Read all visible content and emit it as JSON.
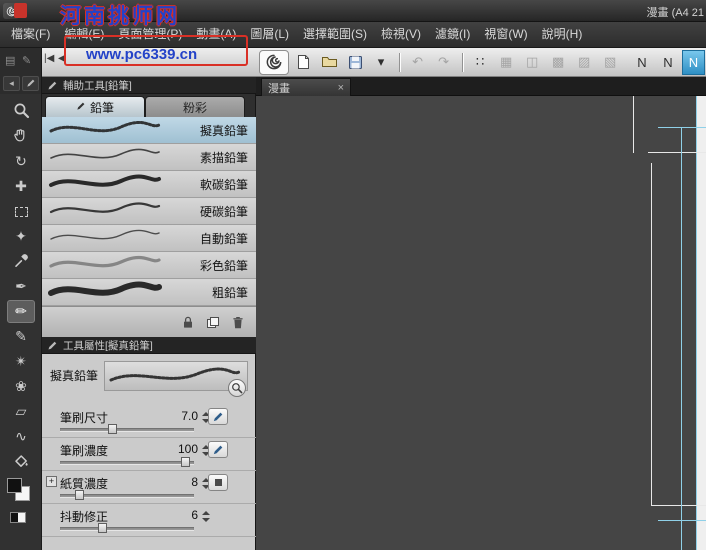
{
  "window": {
    "title": "漫畫 (A4 21"
  },
  "watermark": {
    "line1": "河南挑师网",
    "line2": "www.pc6339.cn"
  },
  "menu": {
    "items": [
      {
        "id": "file",
        "label": "檔案(F)"
      },
      {
        "id": "edit",
        "label": "編輯(E)"
      },
      {
        "id": "page-manage",
        "label": "頁面管理(P)"
      },
      {
        "id": "animation",
        "label": "動畫(A)"
      },
      {
        "id": "layer",
        "label": "圖層(L)"
      },
      {
        "id": "selection",
        "label": "選擇範圍(S)"
      },
      {
        "id": "view",
        "label": "檢視(V)"
      },
      {
        "id": "filter",
        "label": "濾鏡(I)"
      },
      {
        "id": "window",
        "label": "視窗(W)"
      },
      {
        "id": "help",
        "label": "說明(H)"
      }
    ]
  },
  "page_nav": {
    "first": "|◀",
    "prev": "◀"
  },
  "dock": {
    "icon1": "▤",
    "icon2": "✎",
    "collapse": "◂"
  },
  "command_bar": {
    "buttons": [
      {
        "name": "clip-studio-logo-button",
        "type": "logo"
      },
      {
        "name": "new-page-button",
        "type": "icon-new"
      },
      {
        "name": "open-page-button",
        "type": "icon-folder"
      },
      {
        "name": "save-page-button",
        "type": "icon-save"
      },
      {
        "name": "save-options-button",
        "type": "char",
        "glyph": "▾"
      },
      {
        "type": "sep"
      },
      {
        "name": "undo-button",
        "type": "char",
        "glyph": "↶",
        "state": "disabled"
      },
      {
        "name": "redo-button",
        "type": "char",
        "glyph": "↷",
        "state": "disabled"
      },
      {
        "type": "sep"
      },
      {
        "name": "snap-settings-button",
        "type": "char",
        "glyph": "∷"
      },
      {
        "name": "snap-to-ruler-button",
        "type": "char",
        "glyph": "▦",
        "state": "disabled"
      },
      {
        "name": "snap-to-special-ruler-button",
        "type": "char",
        "glyph": "◫",
        "state": "disabled"
      },
      {
        "name": "snap-to-grid-button",
        "type": "char",
        "glyph": "▩",
        "state": "disabled"
      },
      {
        "type": "flex"
      },
      {
        "name": "object-mode-button",
        "type": "char",
        "glyph": "▨",
        "state": "disabled"
      },
      {
        "name": "layer-mode-button",
        "type": "char",
        "glyph": "▧",
        "state": "disabled"
      },
      {
        "type": "gap"
      },
      {
        "name": "vector-snap-1-button",
        "type": "char",
        "glyph": "N"
      },
      {
        "name": "vector-snap-2-button",
        "type": "char",
        "glyph": "N"
      },
      {
        "name": "vector-snap-active-button",
        "type": "char",
        "glyph": "N",
        "state": "active"
      }
    ]
  },
  "tools": [
    {
      "name": "zoom-tool",
      "icon": "zoom"
    },
    {
      "name": "hand-tool",
      "icon": "hand"
    },
    {
      "name": "rotate-tool",
      "icon": "char",
      "glyph": "↻"
    },
    {
      "name": "move-tool",
      "icon": "char",
      "glyph": "✚"
    },
    {
      "name": "selection-tool",
      "icon": "marquee"
    },
    {
      "name": "auto-select-tool",
      "icon": "char",
      "glyph": "✦"
    },
    {
      "name": "eyedropper-tool",
      "icon": "dropper"
    },
    {
      "name": "pen-tool",
      "icon": "char",
      "glyph": "✒"
    },
    {
      "name": "pencil-tool",
      "icon": "char",
      "glyph": "✏",
      "selected": true
    },
    {
      "name": "brush-tool",
      "icon": "char",
      "glyph": "✎"
    },
    {
      "name": "airbrush-tool",
      "icon": "char",
      "glyph": "✴"
    },
    {
      "name": "decoration-tool",
      "icon": "char",
      "glyph": "❀"
    },
    {
      "name": "eraser-tool",
      "icon": "char",
      "glyph": "▱"
    },
    {
      "name": "blend-tool",
      "icon": "char",
      "glyph": "∿"
    },
    {
      "name": "fill-tool",
      "icon": "bucket"
    }
  ],
  "swatches": {
    "foreground": "#111111",
    "background": "#f6f6f6"
  },
  "subtool_panel": {
    "header": "輔助工具[鉛筆]",
    "tabs": [
      {
        "label": "鉛筆",
        "active": true
      },
      {
        "label": "粉彩",
        "active": false
      }
    ],
    "subtools": [
      {
        "label": "擬真鉛筆",
        "selected": true,
        "preview": {
          "w": 3,
          "dash": "2 2",
          "color": "#232323",
          "o": 0.9
        }
      },
      {
        "label": "素描鉛筆",
        "selected": false,
        "preview": {
          "w": 1.6,
          "dash": "",
          "color": "#2a2a2a",
          "o": 0.85
        }
      },
      {
        "label": "軟碳鉛筆",
        "selected": false,
        "preview": {
          "w": 4,
          "dash": "",
          "color": "#1b1b1b",
          "o": 0.92
        }
      },
      {
        "label": "硬碳鉛筆",
        "selected": false,
        "preview": {
          "w": 2.2,
          "dash": "",
          "color": "#222222",
          "o": 0.88
        }
      },
      {
        "label": "自動鉛筆",
        "selected": false,
        "preview": {
          "w": 1.4,
          "dash": "",
          "color": "#2a2a2a",
          "o": 0.8
        }
      },
      {
        "label": "彩色鉛筆",
        "selected": false,
        "preview": {
          "w": 3.2,
          "dash": "",
          "color": "#6e6e6e",
          "o": 0.75
        }
      },
      {
        "label": "粗鉛筆",
        "selected": false,
        "preview": {
          "w": 6,
          "dash": "",
          "color": "#1b1b1b",
          "o": 0.92
        }
      }
    ],
    "footer_icons": [
      {
        "name": "lock-subtool-button",
        "icon": "lock"
      },
      {
        "name": "copy-subtool-button",
        "icon": "dup"
      },
      {
        "name": "delete-subtool-button",
        "icon": "trash"
      }
    ]
  },
  "property_panel": {
    "header": "工具屬性[擬真鉛筆]",
    "preview_label": "擬真鉛筆",
    "sliders": [
      {
        "label": "筆刷尺寸",
        "value": "7.0",
        "fraction": 0.38,
        "button": "stylus",
        "expand": ""
      },
      {
        "label": "筆刷濃度",
        "value": "100",
        "fraction": 0.97,
        "button": "stylus",
        "expand": ""
      },
      {
        "label": "紙質濃度",
        "value": "8",
        "fraction": 0.12,
        "button": "texture",
        "expand": "+"
      },
      {
        "label": "抖動修正",
        "value": "6",
        "fraction": 0.3,
        "button": "",
        "expand": ""
      }
    ]
  },
  "canvas": {
    "tab_label": "漫畫",
    "close_glyph": "×"
  },
  "colors": {
    "toolbar_active_blue": "#2e8fc4",
    "selection_highlight": "#9fc0d2",
    "watermark_blue": "#2342c8",
    "watermark_red": "#d93026",
    "guide_blue": "#8fd0e8",
    "page_white": "#efefef"
  }
}
